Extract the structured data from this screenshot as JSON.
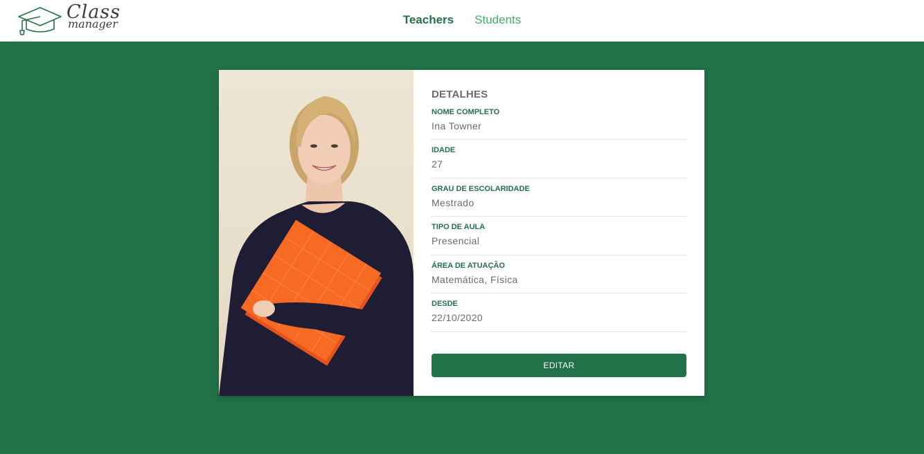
{
  "brand": {
    "logo_line1": "Class",
    "logo_line2": "manager"
  },
  "nav": {
    "items": [
      {
        "label": "Teachers",
        "active": true
      },
      {
        "label": "Students",
        "active": false
      }
    ]
  },
  "details": {
    "heading": "DETALHES",
    "fields": [
      {
        "label": "NOME COMPLETO",
        "value": "Ina Towner"
      },
      {
        "label": "IDADE",
        "value": "27"
      },
      {
        "label": "GRAU DE ESCOLARIDADE",
        "value": "Mestrado"
      },
      {
        "label": "TIPO DE AULA",
        "value": "Presencial"
      },
      {
        "label": "ÁREA DE ATUAÇÃO",
        "value": "Matemática, Física"
      },
      {
        "label": "DESDE",
        "value": "22/10/2020"
      }
    ],
    "edit_button": "EDITAR"
  },
  "colors": {
    "primary": "#227148",
    "nav_inactive": "#3fae67",
    "text_muted": "#6b6b6b"
  }
}
